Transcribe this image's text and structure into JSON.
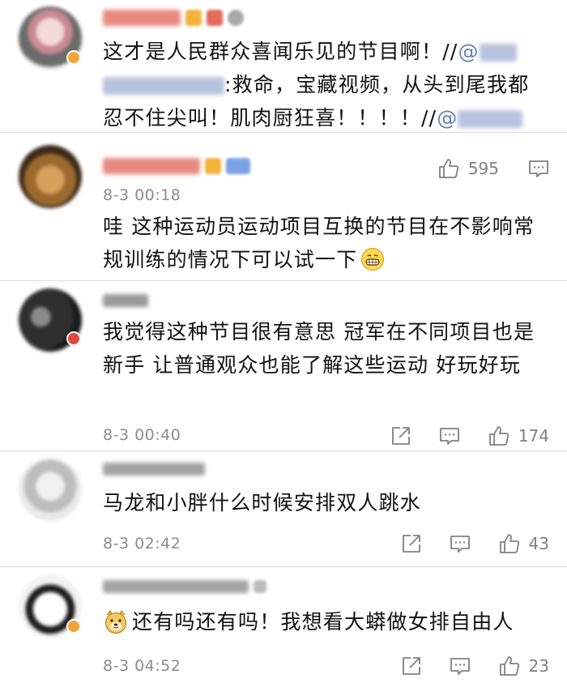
{
  "colors": {
    "link": "#6a7fb0",
    "meta": "#8c8c8c",
    "divider": "#dcdcdc"
  },
  "comments": [
    {
      "id": "c1",
      "text_before": "这才是人民群众喜闻乐见的节目啊！//",
      "mention1": "@",
      "text_middle": ":救命，宝藏视频，从头到尾我都忍不住尖叫！肌肉厨狂喜！！！！//",
      "mention2": "@"
    },
    {
      "id": "c2",
      "timestamp": "8-3 00:18",
      "likes": "595",
      "text": "哇 这种运动员运动项目互换的节目在不影响常规训练的情况下可以试一下"
    },
    {
      "id": "c3",
      "timestamp": "8-3 00:40",
      "likes": "174",
      "text": "我觉得这种节目很有意思 冠军在不同项目也是新手 让普通观众也能了解这些运动 好玩好玩"
    },
    {
      "id": "c4",
      "timestamp": "8-3 02:42",
      "likes": "43",
      "text": "马龙和小胖什么时候安排双人跳水"
    },
    {
      "id": "c5",
      "timestamp": "8-3 04:52",
      "likes": "23",
      "text": "还有吗还有吗！我想看大蟒做女排自由人"
    }
  ]
}
